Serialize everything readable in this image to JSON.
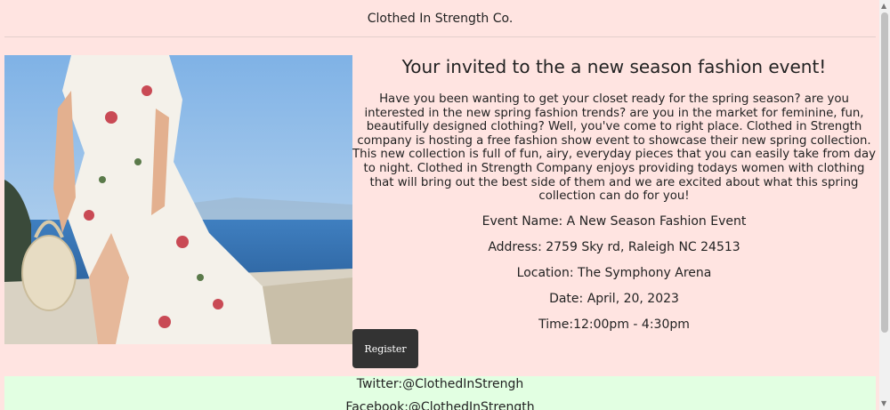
{
  "header": {
    "title": "Clothed In Strength Co."
  },
  "event": {
    "heading": "Your invited to the a new season fashion event!",
    "description": "Have you been wanting to get your closet ready for the spring season? are you interested in the new spring fashion trends? are you in the market for feminine, fun, beautifully designed clothing? Well, you've come to right place. Clothed in Strength company is hosting a free fashion show event to showcase their new spring collection. This new collection is full of fun, airy, everyday pieces that you can easily take from day to night. Clothed in Strength Company enjoys providing todays women with clothing that will bring out the best side of them and we are excited about what this spring collection can do for you!",
    "name": "Event Name: A New Season Fashion Event",
    "address": "Address: 2759 Sky rd, Raleigh NC 24513",
    "location": "Location: The Symphony Arena",
    "date": "Date: April, 20, 2023",
    "time": "Time:12:00pm - 4:30pm"
  },
  "register": {
    "label": "Register"
  },
  "footer": {
    "twitter": "Twitter:@ClothedInStrengh",
    "facebook": "Facebook:@ClothedInStrength"
  },
  "colors": {
    "page_bg": "#ffe4e1",
    "footer_bg": "#e2ffe2",
    "button_bg": "#333333"
  }
}
